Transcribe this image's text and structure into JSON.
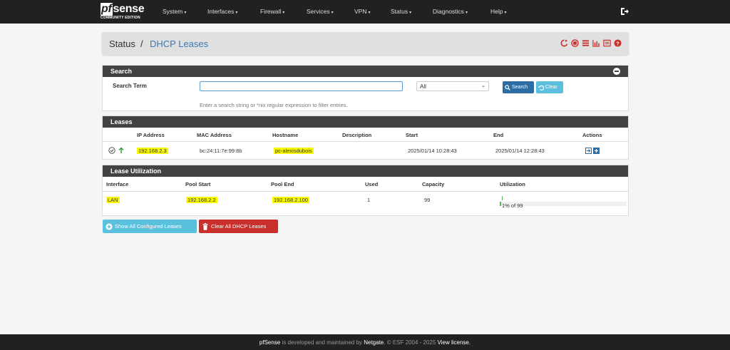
{
  "brand": {
    "logo_pf": "pf",
    "logo_rest": "sense",
    "edition": "COMMUNITY EDITION"
  },
  "nav": {
    "items": [
      {
        "label": "System"
      },
      {
        "label": "Interfaces"
      },
      {
        "label": "Firewall"
      },
      {
        "label": "Services"
      },
      {
        "label": "VPN"
      },
      {
        "label": "Status"
      },
      {
        "label": "Diagnostics"
      },
      {
        "label": "Help"
      }
    ],
    "logout_icon": "sign-out-icon"
  },
  "breadcrumb": {
    "section": "Status",
    "separator": "/",
    "page": "DHCP Leases"
  },
  "search": {
    "title": "Search",
    "term_label": "Search Term",
    "term_value": "",
    "select_value": "All",
    "search_button": "Search",
    "clear_button": "Clear",
    "hint": "Enter a search string or *nix regular expression to filter entries."
  },
  "leases": {
    "title": "Leases",
    "headers": {
      "ip": "IP Address",
      "mac": "MAC Address",
      "hostname": "Hostname",
      "description": "Description",
      "start": "Start",
      "end": "End",
      "actions": "Actions"
    },
    "rows": [
      {
        "ip": "192.168.2.3",
        "mac": "bc:24:11:7e:99:8b",
        "hostname": "pc-alexisdubois",
        "description": "",
        "start": "2025/01/14 10:28:43",
        "end": "2025/01/14 12:28:43"
      }
    ]
  },
  "utilization": {
    "title": "Lease Utilization",
    "headers": {
      "interface": "Interface",
      "pool_start": "Pool Start",
      "pool_end": "Pool End",
      "used": "Used",
      "capacity": "Capacity",
      "utilization": "Utilization"
    },
    "rows": [
      {
        "interface": "LAN",
        "pool_start": "192.168.2.2",
        "pool_end": "192.168.2.100",
        "used": "1",
        "capacity": "99",
        "utilization_text": "1% of 99",
        "utilization_fraction": 0.01
      }
    ]
  },
  "buttons": {
    "show_all": "Show All Configured Leases",
    "clear_all": "Clear All DHCP Leases"
  },
  "footer": {
    "product": "pfSense",
    "text1": " is developed and maintained by ",
    "company": "Netgate",
    "text2": ". © ESF 2004 - 2025 ",
    "license": "View license."
  },
  "colors": {
    "nav_bg": "#212121",
    "panel_head": "#424242",
    "link_blue": "#3b7ab3",
    "info": "#5bc0de",
    "primary": "#2e6da4",
    "danger": "#c9302c",
    "highlight": "#f9f900"
  }
}
